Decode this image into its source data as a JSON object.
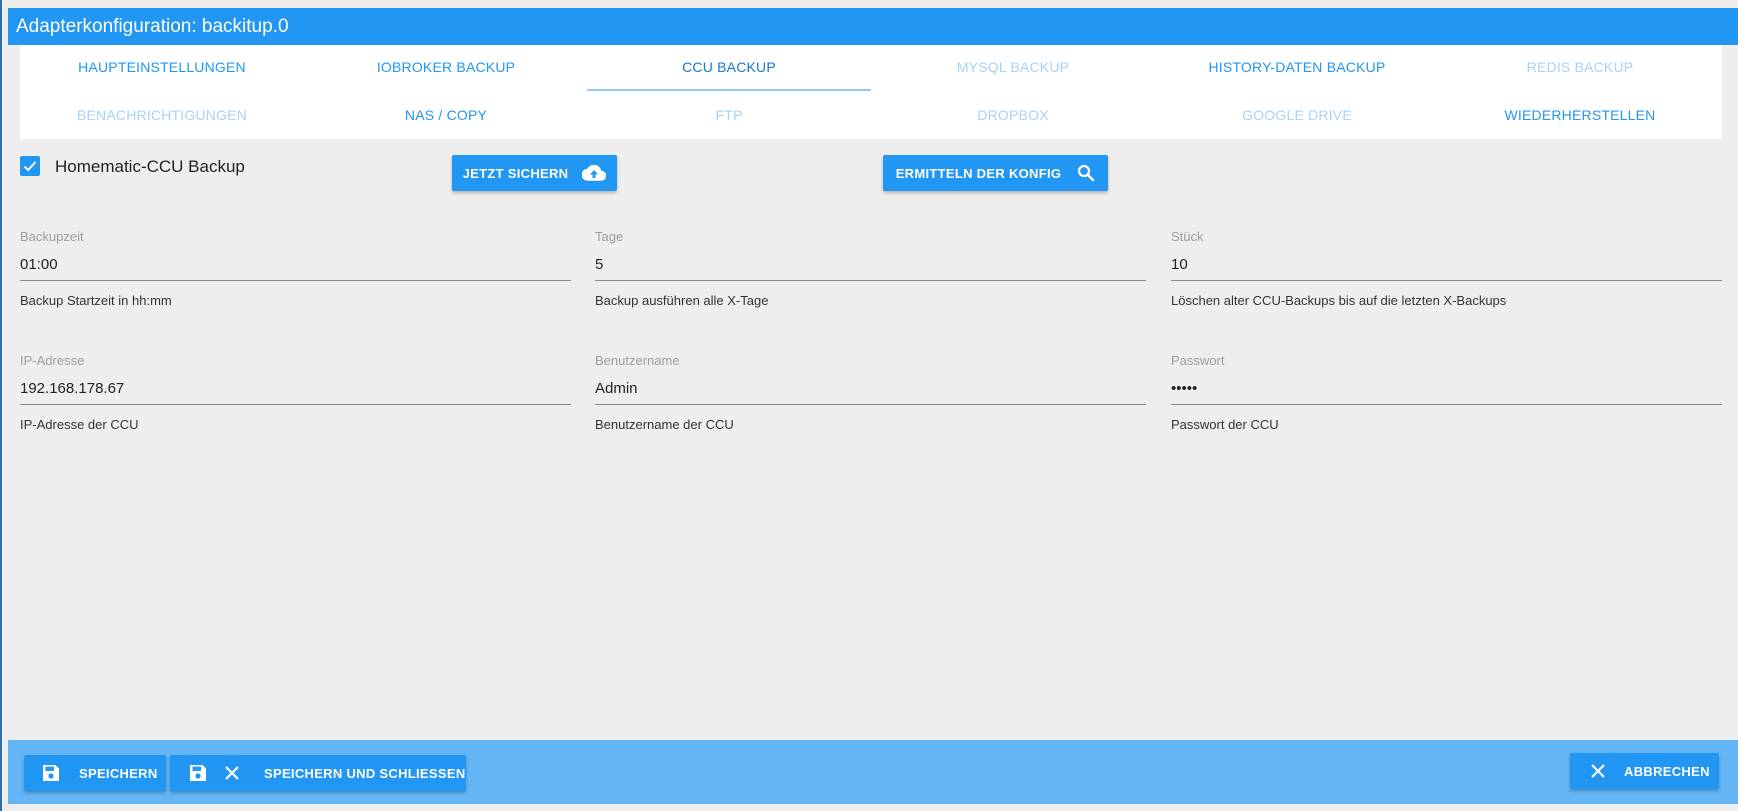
{
  "window": {
    "title": "Adapterkonfiguration: backitup.0"
  },
  "tabs": {
    "row1": [
      {
        "label": "HAUPTEINSTELLUNGEN",
        "state": "enabled"
      },
      {
        "label": "IOBROKER BACKUP",
        "state": "enabled"
      },
      {
        "label": "CCU BACKUP",
        "state": "active"
      },
      {
        "label": "MYSQL BACKUP",
        "state": "disabled"
      },
      {
        "label": "HISTORY-DATEN BACKUP",
        "state": "enabled"
      },
      {
        "label": "REDIS BACKUP",
        "state": "disabled"
      }
    ],
    "row2": [
      {
        "label": "BENACHRICHTIGUNGEN",
        "state": "disabled"
      },
      {
        "label": "NAS / COPY",
        "state": "enabled"
      },
      {
        "label": "FTP",
        "state": "disabled"
      },
      {
        "label": "DROPBOX",
        "state": "disabled"
      },
      {
        "label": "GOOGLE DRIVE",
        "state": "disabled"
      },
      {
        "label": "WIEDERHERSTELLEN",
        "state": "enabled"
      }
    ]
  },
  "ccu": {
    "enable_label": "Homematic-CCU Backup",
    "enabled": true,
    "backup_now_label": "JETZT SICHERN",
    "detect_config_label": "ERMITTELN DER KONFIG"
  },
  "fields": {
    "backupzeit": {
      "label": "Backupzeit",
      "value": "01:00",
      "helper": "Backup Startzeit in hh:mm"
    },
    "tage": {
      "label": "Tage",
      "value": "5",
      "helper": "Backup ausführen alle X-Tage"
    },
    "stueck": {
      "label": "Stück",
      "value": "10",
      "helper": "Löschen alter CCU-Backups bis auf die letzten X-Backups"
    },
    "ip": {
      "label": "IP-Adresse",
      "value": "192.168.178.67",
      "helper": "IP-Adresse der CCU"
    },
    "benutzername": {
      "label": "Benutzername",
      "value": "Admin",
      "helper": "Benutzername der CCU"
    },
    "passwort": {
      "label": "Passwort",
      "value": "•••••",
      "helper": "Passwort der CCU"
    }
  },
  "footer": {
    "save_label": "SPEICHERN",
    "save_close_label": "SPEICHERN UND SCHLIESSEN",
    "cancel_label": "ABBRECHEN"
  },
  "icons": {
    "checkbox": "check-icon",
    "backup_now": "cloud-upload-icon",
    "detect_config": "search-icon",
    "save": "floppy-disk-icon",
    "close": "close-icon"
  },
  "colors": {
    "primary": "#2196f3",
    "tab_disabled": "#a8d2f7",
    "tab_active": "#1976d2",
    "footer_bar": "#64b5f6",
    "background": "#eeeeee"
  }
}
